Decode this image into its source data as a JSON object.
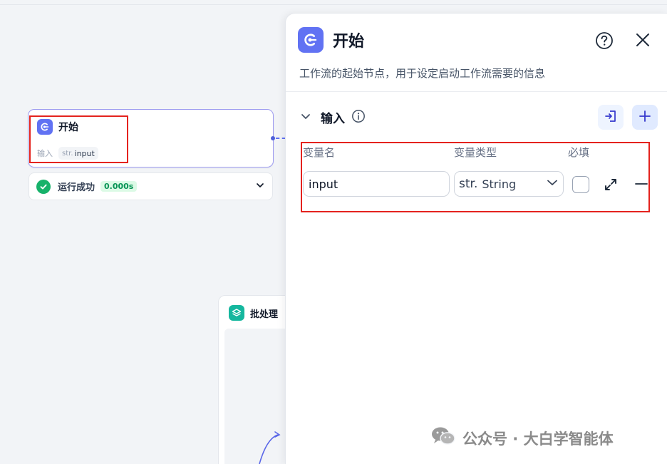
{
  "start_node": {
    "title": "开始",
    "inputs_label": "输入",
    "var_type": "str.",
    "var_name": "input"
  },
  "run_status": {
    "label": "运行成功",
    "duration": "0.000s"
  },
  "batch_node": {
    "title": "批处理"
  },
  "panel": {
    "title": "开始",
    "description": "工作流的起始节点，用于设定启动工作流需要的信息",
    "section_title": "输入",
    "columns": {
      "name": "变量名",
      "type": "变量类型",
      "required": "必填"
    },
    "variable": {
      "name": "input",
      "type_prefix": "str.",
      "type_label": "String",
      "required": false
    }
  },
  "watermark": {
    "text": "公众号 · 大白学智能体"
  },
  "colors": {
    "accent": "#6172f3",
    "highlight_box": "#e4231e",
    "success": "#17b26a",
    "batch": "#15b79e"
  },
  "icons": {
    "node": "start-node-icon",
    "help": "help-circle-icon",
    "close": "close-icon",
    "info": "info-icon",
    "import": "import-icon",
    "add": "plus-icon",
    "expand": "expand-icon",
    "remove": "minus-icon",
    "success": "check-circle-icon",
    "batch": "layers-icon"
  }
}
